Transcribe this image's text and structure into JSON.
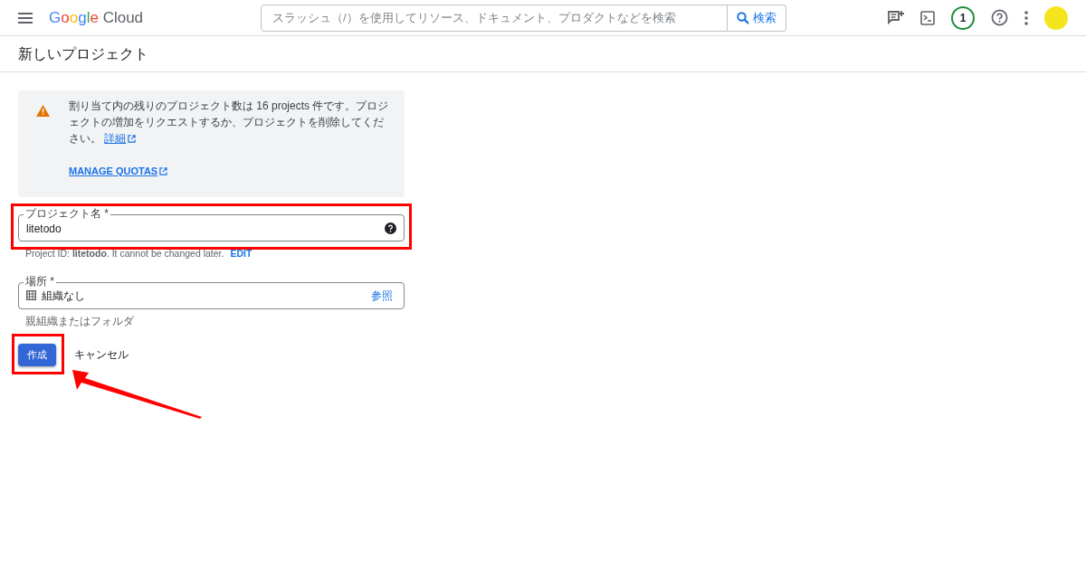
{
  "header": {
    "logo_word": "Google",
    "logo_product": "Cloud",
    "search": {
      "placeholder": "スラッシュ（/）を使用してリソース、ドキュメント、プロダクトなどを検索",
      "button": "検索"
    },
    "notification_count": "1"
  },
  "page_title": "新しいプロジェクト",
  "quota_notice": {
    "text": "割り当て内の残りのプロジェクト数は 16 projects 件です。プロジェクトの増加をリクエストするか、プロジェクトを削除してください。",
    "link": "詳細",
    "manage_link": "MANAGE QUOTAS"
  },
  "project_name": {
    "label": "プロジェクト名 *",
    "value": "litetodo",
    "hint": "Project ID: **litetodo**. It cannot be changed later.",
    "hint_action": "EDIT",
    "highlighted": true
  },
  "location": {
    "label": "場所 *",
    "value": "組織なし",
    "action": "参照",
    "hint": "親組織またはフォルダ"
  },
  "buttons": [
    {
      "label": "作成",
      "kind": "primary",
      "highlighted": true
    },
    {
      "label": "キャンセル",
      "kind": "text",
      "highlighted": false
    }
  ],
  "pointer_arrow": true
}
